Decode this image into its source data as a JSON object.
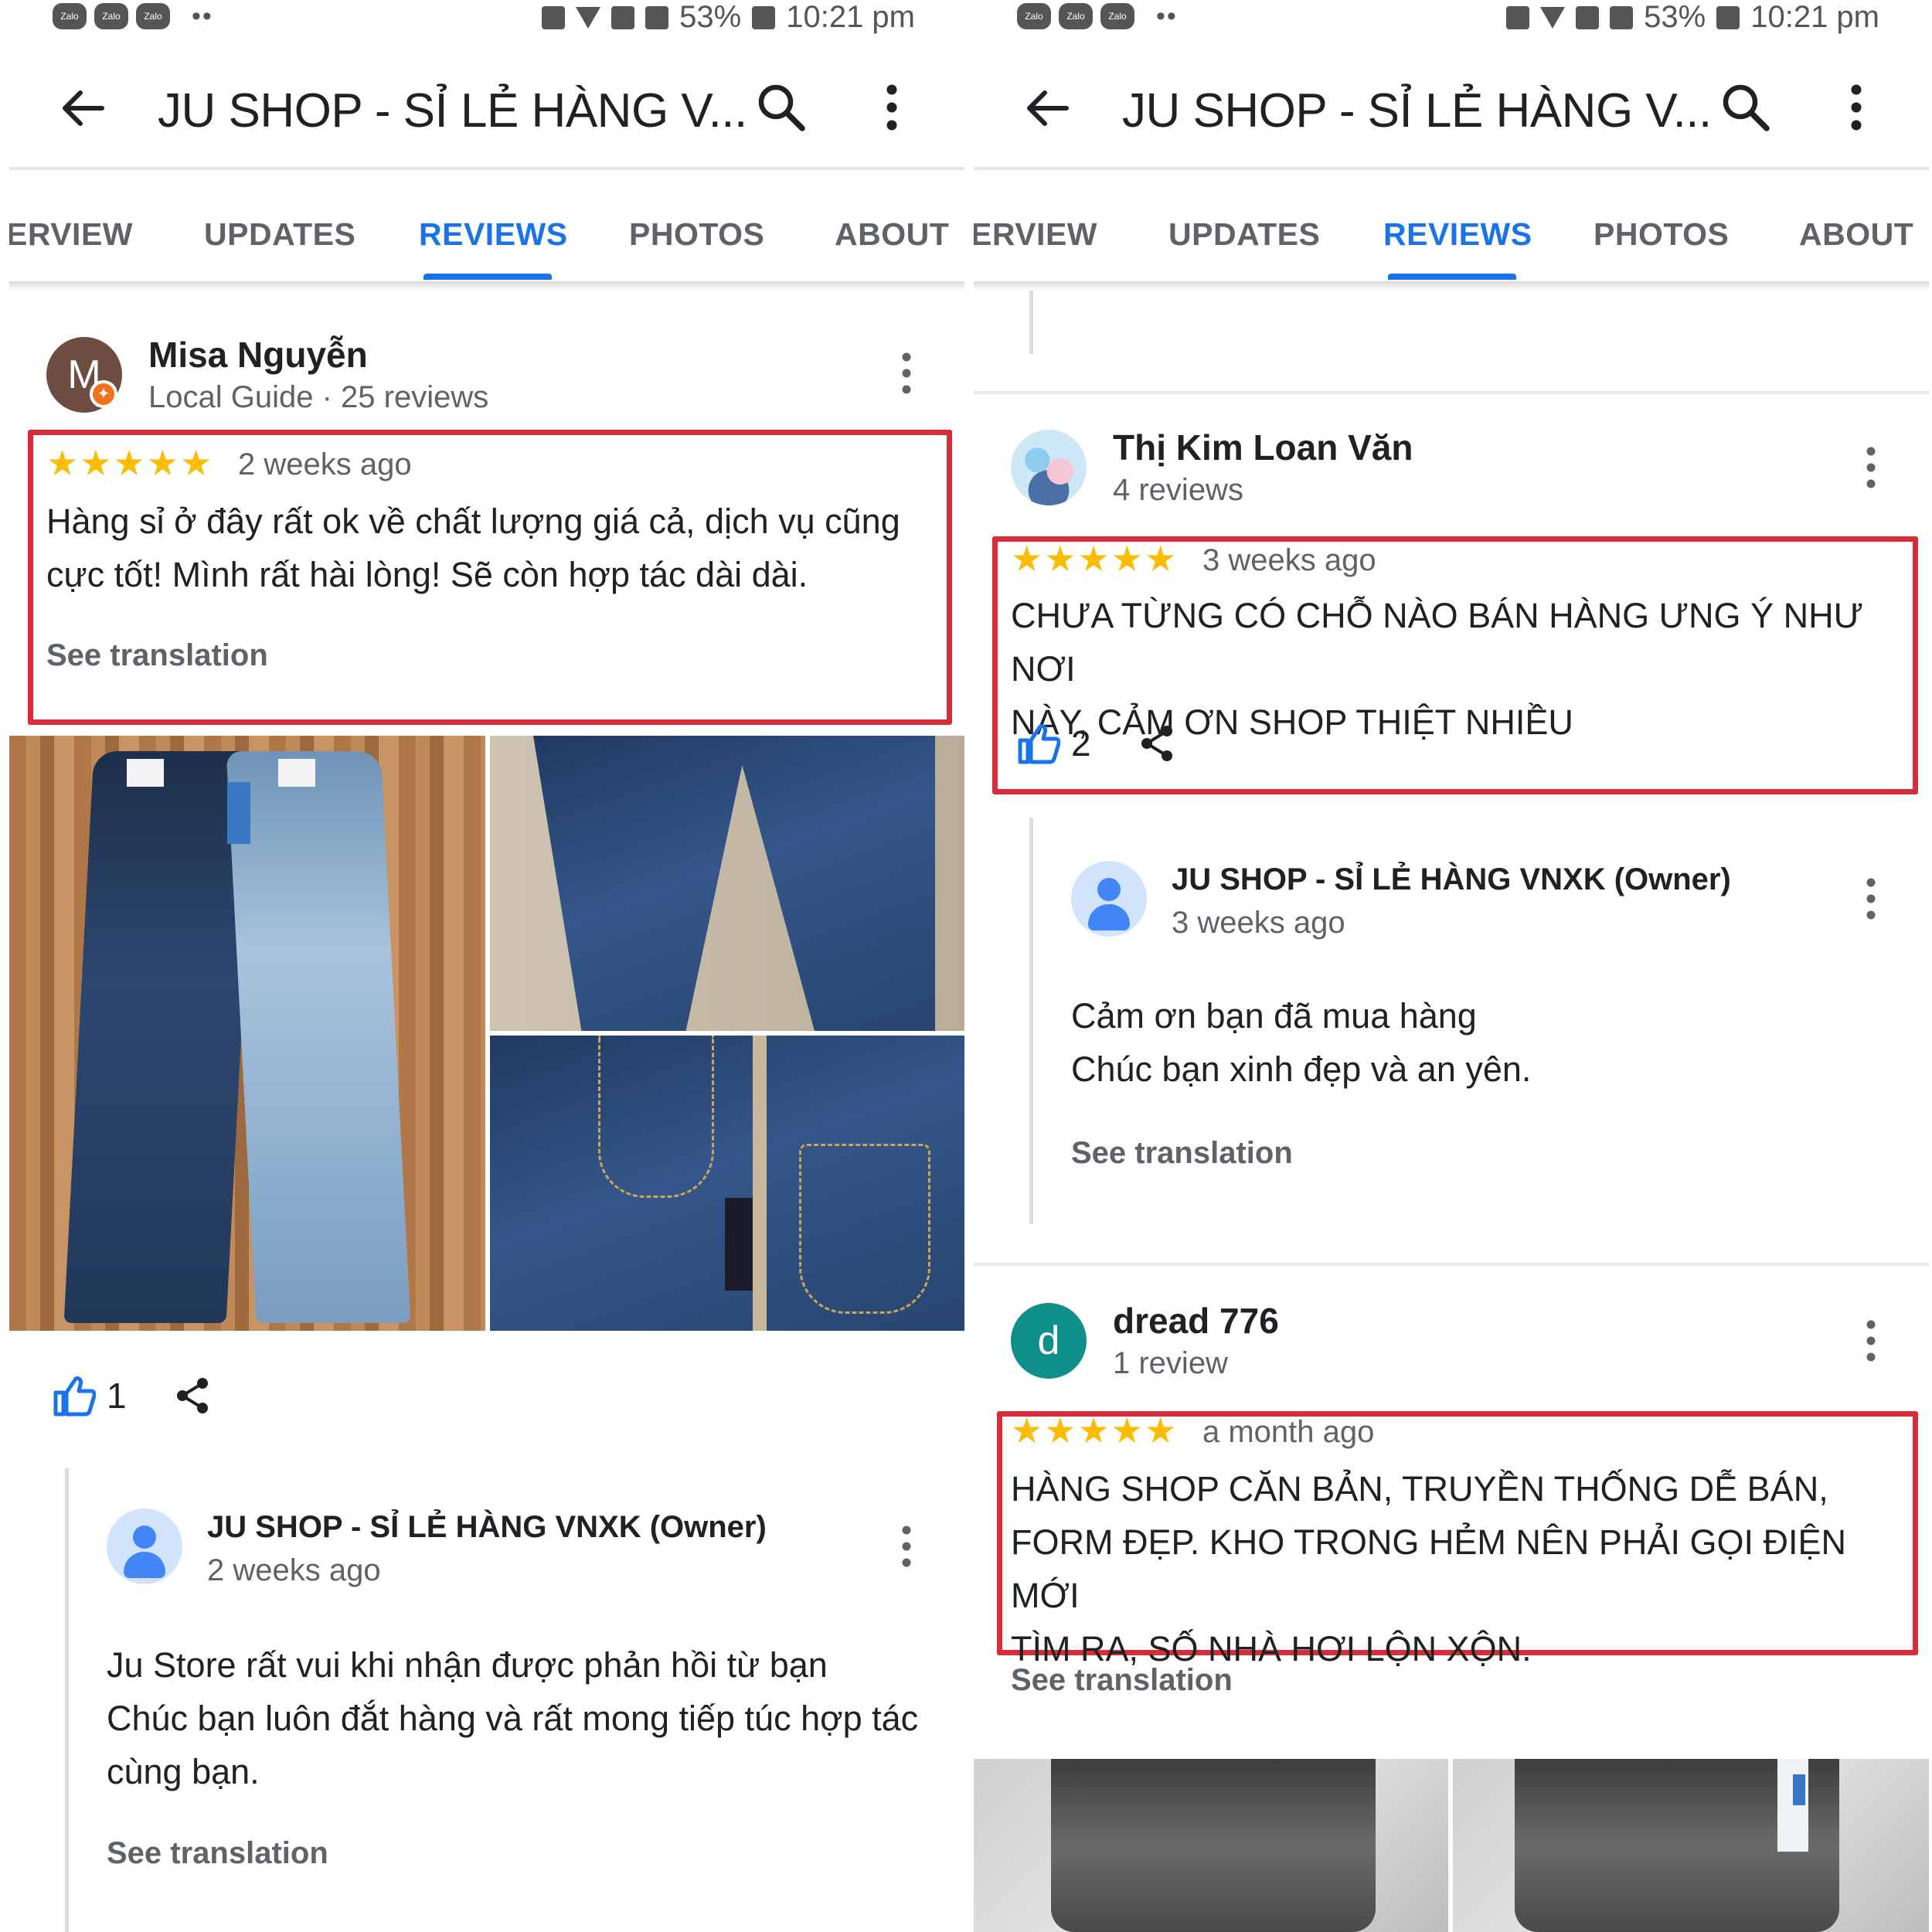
{
  "status_bar": {
    "app_icons": [
      "Zalo",
      "Zalo",
      "Zalo"
    ],
    "more_dots": "••",
    "battery": "53%",
    "time": "10:21 pm"
  },
  "app_bar": {
    "title": "JU SHOP - SỈ LẺ HÀNG V..."
  },
  "tabs": [
    "ERVIEW",
    "UPDATES",
    "REVIEWS",
    "PHOTOS",
    "ABOUT"
  ],
  "active_tab": "REVIEWS",
  "colors": {
    "accent": "#1a73e8",
    "highlight_box": "#d92c3a",
    "star": "#fbbc04"
  },
  "left_panel": {
    "review": {
      "avatar_letter": "M",
      "name": "Misa Nguyễn",
      "meta": "Local Guide · 25 reviews",
      "stars": "★★★★★",
      "time": "2 weeks ago",
      "text": "Hàng sỉ ở đây rất ok về chất lượng giá cả, dịch vụ cũng\ncực tốt! Mình rất hài lòng! Sẽ còn hợp tác dài dài.",
      "see_translation": "See translation",
      "likes": "1"
    },
    "owner_reply": {
      "name": "JU SHOP - SỈ LẺ HÀNG VNXK (Owner)",
      "time": "2 weeks ago",
      "text": "Ju Store rất vui khi nhận được phản hồi từ bạn\nChúc bạn luôn đắt hàng và rất mong tiếp túc hợp tác\ncùng bạn.",
      "see_translation": "See translation"
    }
  },
  "right_panel": {
    "partial_see_translation": "See translation",
    "review1": {
      "name": "Thị Kim Loan Văn",
      "meta": "4 reviews",
      "stars": "★★★★★",
      "time": "3 weeks ago",
      "text": "CHƯA TỪNG CÓ CHỖ NÀO BÁN HÀNG ƯNG Ý NHƯ NƠI\nNÀY, CẢM ƠN SHOP THIỆT NHIỀU",
      "likes": "2"
    },
    "owner_reply": {
      "name": "JU SHOP - SỈ LẺ HÀNG VNXK (Owner)",
      "time": "3 weeks ago",
      "text": "Cảm ơn bạn đã mua hàng\nChúc bạn xinh đẹp và an yên.",
      "see_translation": "See translation"
    },
    "review2": {
      "avatar_letter": "d",
      "name": "dread 776",
      "meta": "1 review",
      "stars": "★★★★★",
      "time": "a month ago",
      "text": "HÀNG SHOP CĂN BẢN, TRUYỀN THỐNG DỄ BÁN,\nFORM ĐẸP. KHO TRONG HẺM NÊN PHẢI GỌI ĐIỆN MỚI\nTÌM RA, SỐ NHÀ HƠI LỘN XỘN.",
      "see_translation": "See translation"
    }
  }
}
